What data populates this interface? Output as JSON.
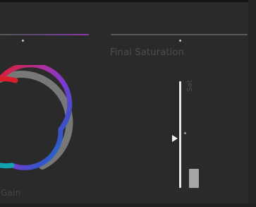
{
  "labels": {
    "final_saturation": "Final Saturation",
    "gain": "Gain",
    "sat": "Sat"
  },
  "controls": {
    "left_slider": {
      "value": 1.0,
      "color": "#8b37b0"
    },
    "final_saturation_slider": {
      "value": 0.5
    },
    "saturation_scale": {
      "value": 0.5,
      "block_value": 0.18
    }
  },
  "colors": {
    "background": "#2a2a2b",
    "muted_text": "#4d4d4d",
    "wheel_ring": "#787878",
    "accent": "#8b37b0"
  },
  "icons": {
    "wheel": "color-wheel-icon",
    "pointer": "triangle-pointer-icon"
  }
}
